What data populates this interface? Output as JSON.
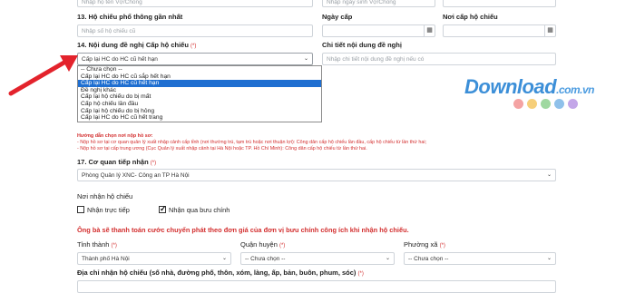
{
  "row_spouse": {
    "name_placeholder": "Nhập họ tên Vợ/Chồng",
    "dob_placeholder": "Nhập ngày sinh Vợ/Chồng"
  },
  "section13": {
    "label": "13. Hộ chiếu phổ thông gần nhất",
    "passport_placeholder": "Nhập số hộ chiếu cũ",
    "issue_date_label": "Ngày cấp",
    "issue_place_label": "Nơi cấp hộ chiếu"
  },
  "section14": {
    "label": "14. Nội dung đề nghị Cấp hộ chiếu",
    "required_mark": "(*)",
    "selected_value": "Cấp lại HC do HC cũ hết hạn",
    "detail_label": "Chi tiết nội dung đề nghị",
    "detail_placeholder": "Nhập chi tiết nội dung đề nghị nếu có",
    "options": [
      "-- Chưa chọn --",
      "Cấp lại HC do HC cũ sắp hết hạn",
      "Cấp lại HC do HC cũ hết hạn",
      "Đề nghị khác",
      "Cấp lại hộ chiếu do bị mất",
      "Cấp hộ chiếu lần đầu",
      "Cấp lại hộ chiếu do bị hỏng",
      "Cấp lại HC do HC cũ hết trang"
    ],
    "selected_index": 2
  },
  "guide": {
    "title": "Hướng dẫn chọn nơi nộp hồ sơ:",
    "line1": "- Nộp hồ sơ tại cơ quan quản lý xuất nhập cảnh cấp tỉnh (nơi thường trú, tạm trú hoặc nơi thuận lợi): Công dân cấp hộ chiếu lần đầu, cấp hộ chiếu từ lần thứ hai;",
    "line2": "- Nộp hồ sơ tại cấp trung ương (Cục Quản lý xuất nhập cảnh tại Hà Nội hoặc TP. Hồ Chí Minh): Công dân cấp hộ chiếu từ lần thứ hai."
  },
  "section17": {
    "label": "17. Cơ quan tiếp nhận",
    "required_mark": "(*)",
    "value": "Phòng Quản lý XNC- Công an TP Hà Nội"
  },
  "receive": {
    "label": "Nơi nhận hộ chiếu",
    "option_direct": "Nhận trực tiếp",
    "option_direct_checked": false,
    "option_post": "Nhận qua bưu chính",
    "option_post_checked": true
  },
  "notice": "Ông bà sẽ thanh toán cước chuyển phát theo đơn giá của đơn vị bưu chính công ích khi nhận hộ chiếu.",
  "address": {
    "province_label": "Tỉnh thành",
    "province_value": "Thành phố Hà Nội",
    "district_label": "Quận huyện",
    "district_value": "-- Chưa chọn --",
    "ward_label": "Phường xã",
    "ward_value": "-- Chưa chọn --",
    "required_mark": "(*)",
    "detail_label": "Địa chỉ nhận hộ chiếu (số nhà, đường phố, thôn, xóm, làng, ấp, bản, buôn, phum, sóc)"
  },
  "watermark": {
    "brand": "Download",
    "domain": ".com.vn",
    "dot_colors": [
      "#f4a3a3",
      "#f6cf7a",
      "#9fd8a0",
      "#8fc1ea",
      "#c3a6e8"
    ]
  },
  "icons": {
    "calendar": "▦",
    "chevron": "⌄",
    "check": "✓"
  },
  "colors": {
    "required": "#d32f2f",
    "selected_option": "#1f6fd1",
    "arrow": "#e3232c",
    "brand": "#3c8fd8"
  }
}
